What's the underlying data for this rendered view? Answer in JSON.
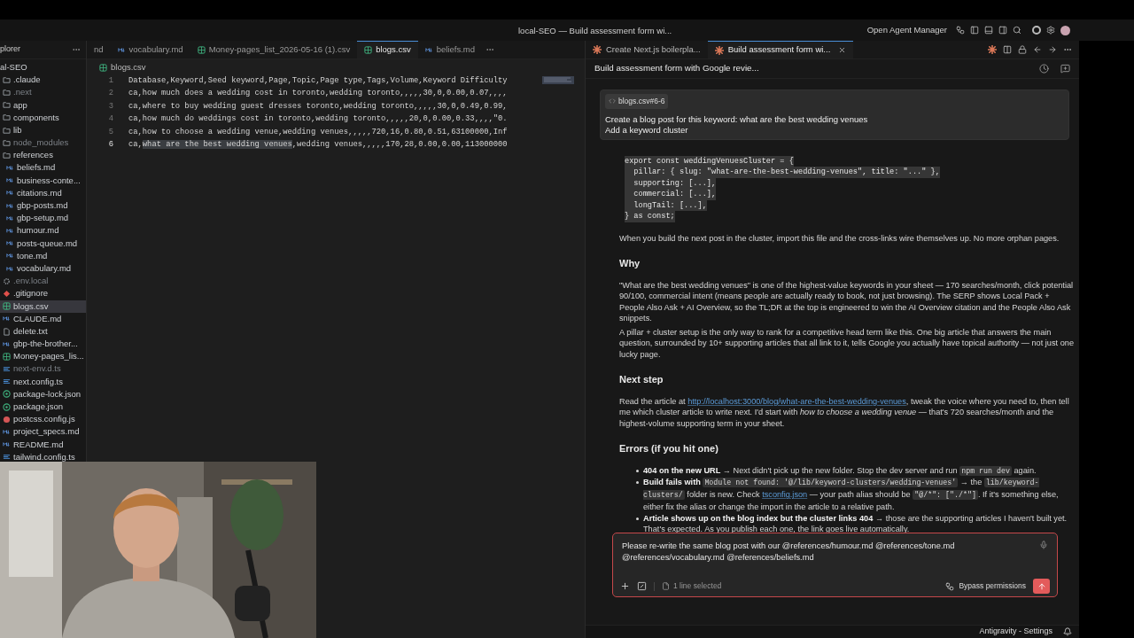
{
  "window": {
    "title": "local-SEO — Build assessment form wi..."
  },
  "title_bar": {
    "button": "Open Agent Manager"
  },
  "explorer": {
    "title": "plorer",
    "root": "al-SEO",
    "items": [
      {
        "label": ".claude",
        "kind": "folder",
        "dimmed": false,
        "selected": false
      },
      {
        "label": ".next",
        "kind": "folder",
        "dimmed": true,
        "selected": false
      },
      {
        "label": "app",
        "kind": "folder",
        "dimmed": false,
        "selected": false
      },
      {
        "label": "components",
        "kind": "folder",
        "dimmed": false,
        "selected": false
      },
      {
        "label": "lib",
        "kind": "folder",
        "dimmed": false,
        "selected": false
      },
      {
        "label": "node_modules",
        "kind": "folder",
        "dimmed": true,
        "selected": false
      },
      {
        "label": "references",
        "kind": "folder",
        "dimmed": false,
        "selected": false,
        "children": [
          {
            "label": "beliefs.md",
            "kind": "md",
            "dimmed": false,
            "selected": false
          },
          {
            "label": "business-conte...",
            "kind": "md",
            "dimmed": false,
            "selected": false
          },
          {
            "label": "citations.md",
            "kind": "md",
            "dimmed": false,
            "selected": false
          },
          {
            "label": "gbp-posts.md",
            "kind": "md",
            "dimmed": false,
            "selected": false
          },
          {
            "label": "gbp-setup.md",
            "kind": "md",
            "dimmed": false,
            "selected": false
          },
          {
            "label": "humour.md",
            "kind": "md",
            "dimmed": false,
            "selected": false
          },
          {
            "label": "posts-queue.md",
            "kind": "md",
            "dimmed": false,
            "selected": false
          },
          {
            "label": "tone.md",
            "kind": "md",
            "dimmed": false,
            "selected": false
          },
          {
            "label": "vocabulary.md",
            "kind": "md",
            "dimmed": false,
            "selected": false
          }
        ]
      },
      {
        "label": ".env.local",
        "kind": "env",
        "dimmed": true,
        "selected": false
      },
      {
        "label": ".gitignore",
        "kind": "git",
        "dimmed": false,
        "selected": false
      },
      {
        "label": "blogs.csv",
        "kind": "csv",
        "dimmed": false,
        "selected": true
      },
      {
        "label": "CLAUDE.md",
        "kind": "md",
        "dimmed": false,
        "selected": false
      },
      {
        "label": "delete.txt",
        "kind": "txt",
        "dimmed": false,
        "selected": false
      },
      {
        "label": "gbp-the-brother...",
        "kind": "md",
        "dimmed": false,
        "selected": false
      },
      {
        "label": "Money-pages_lis...",
        "kind": "csv",
        "dimmed": false,
        "selected": false
      },
      {
        "label": "next-env.d.ts",
        "kind": "ts",
        "dimmed": true,
        "selected": false
      },
      {
        "label": "next.config.ts",
        "kind": "ts",
        "dimmed": false,
        "selected": false
      },
      {
        "label": "package-lock.json",
        "kind": "json",
        "dimmed": false,
        "selected": false
      },
      {
        "label": "package.json",
        "kind": "json",
        "dimmed": false,
        "selected": false
      },
      {
        "label": "postcss.config.js",
        "kind": "js",
        "dimmed": false,
        "selected": false
      },
      {
        "label": "project_specs.md",
        "kind": "md",
        "dimmed": false,
        "selected": false
      },
      {
        "label": "README.md",
        "kind": "md",
        "dimmed": false,
        "selected": false
      },
      {
        "label": "tailwind.config.ts",
        "kind": "ts",
        "dimmed": false,
        "selected": false
      }
    ]
  },
  "editor_tabs": [
    {
      "label": "nd",
      "kind": "none",
      "selected": false
    },
    {
      "label": "vocabulary.md",
      "kind": "md",
      "selected": false
    },
    {
      "label": "Money-pages_list_2026-05-16 (1).csv",
      "kind": "csv",
      "selected": false
    },
    {
      "label": "blogs.csv",
      "kind": "csv",
      "selected": true
    },
    {
      "label": "beliefs.md",
      "kind": "md",
      "selected": false
    }
  ],
  "editor": {
    "file": "blogs.csv",
    "lines": [
      {
        "number": "1",
        "active": false,
        "parts": [
          {
            "text": "Database,Keyword,Seed keyword,Page,Topic,Page type,Tags,Volume,Keyword Difficulty",
            "selected": false
          }
        ]
      },
      {
        "number": "2",
        "active": false,
        "parts": [
          {
            "text": "ca,how much does a wedding cost in toronto,wedding toronto,,,,,30,0,0.00,0.07,,,,",
            "selected": false
          }
        ]
      },
      {
        "number": "3",
        "active": false,
        "parts": [
          {
            "text": "ca,where to buy wedding guest dresses toronto,wedding toronto,,,,,30,0,0.49,0.99,",
            "selected": false
          }
        ]
      },
      {
        "number": "4",
        "active": false,
        "parts": [
          {
            "text": "ca,how much do weddings cost in toronto,wedding toronto,,,,,20,0,0.00,0.33,,,,\"0.",
            "selected": false
          }
        ]
      },
      {
        "number": "5",
        "active": false,
        "parts": [
          {
            "text": "ca,how to choose a wedding venue,wedding venues,,,,,720,16,0.80,0.51,63100000,Inf",
            "selected": false
          }
        ]
      },
      {
        "number": "6",
        "active": true,
        "parts": [
          {
            "text": "ca,",
            "selected": false
          },
          {
            "text": "what are the best wedding venues",
            "selected": true
          },
          {
            "text": ",wedding venues,,,,,170,28,0.00,0.00,113000000",
            "selected": false
          }
        ]
      }
    ]
  },
  "chat_tabs": [
    {
      "label": "Create Next.js boilerpla...",
      "selected": false
    },
    {
      "label": "Build assessment form wi...",
      "selected": true
    }
  ],
  "chat": {
    "title": "Build assessment form with Google revie...",
    "prompt": {
      "chip": "blogs.csv#6-6",
      "lines": [
        "Create a blog post for this keyword: what are the best wedding venues",
        "Add a keyword cluster"
      ]
    },
    "blocks": [
      {
        "kind": "code",
        "lines": [
          "export const weddingVenuesCluster = {",
          "  pillar: { slug: \"what-are-the-best-wedding-venues\", title: \"...\" },",
          "  supporting: [...],",
          "  commercial: [...],",
          "  longTail: [...],",
          "} as const;"
        ]
      },
      {
        "kind": "paragraph",
        "segments": [
          {
            "kind": "text",
            "text": "When you build the next post in the cluster, import this file and the cross-links wire themselves up. No more orphan pages."
          }
        ]
      },
      {
        "kind": "heading",
        "text": "Why"
      },
      {
        "kind": "paragraph",
        "segments": [
          {
            "kind": "text",
            "text": "\"What are the best wedding venues\" is one of the highest-value keywords in your sheet — 170 searches/month, click potential 90/100, commercial intent (means people are actually ready to book, not just browsing). The SERP shows Local Pack + People Also Ask + AI Overview, so the TL;DR at the top is engineered to win the AI Overview citation and the People Also Ask snippets."
          }
        ]
      },
      {
        "kind": "paragraph",
        "segments": [
          {
            "kind": "text",
            "text": "A pillar + cluster setup is the only way to rank for a competitive head term like this. One big article that answers the main question, surrounded by 10+ supporting articles that all link to it, tells Google you actually have topical authority — not just one lucky page."
          }
        ]
      },
      {
        "kind": "heading",
        "text": "Next step"
      },
      {
        "kind": "paragraph",
        "segments": [
          {
            "kind": "text",
            "text": "Read the article at "
          },
          {
            "kind": "link",
            "text": "http://localhost:3000/blog/what-are-the-best-wedding-venues"
          },
          {
            "kind": "text",
            "text": ", tweak the voice where you need to, then tell me which cluster article to write next. I'd start with "
          },
          {
            "kind": "italic",
            "text": "how to choose a wedding venue"
          },
          {
            "kind": "text",
            "text": " — that's 720 searches/month and the highest-volume supporting term in your sheet."
          }
        ]
      },
      {
        "kind": "heading",
        "text": "Errors (if you hit one)"
      },
      {
        "kind": "list",
        "items": [
          [
            {
              "kind": "bold",
              "text": "404 on the new URL"
            },
            {
              "kind": "text",
              "text": " → Next didn't pick up the new folder. Stop the dev server and run "
            },
            {
              "kind": "code",
              "text": "npm run dev"
            },
            {
              "kind": "text",
              "text": " again."
            }
          ],
          [
            {
              "kind": "bold",
              "text": "Build fails with "
            },
            {
              "kind": "code",
              "text": "Module not found: '@/lib/keyword-clusters/wedding-venues'"
            },
            {
              "kind": "text",
              "text": " → the "
            },
            {
              "kind": "code",
              "text": "lib/keyword-clusters/"
            },
            {
              "kind": "text",
              "text": " folder is new. Check "
            },
            {
              "kind": "link",
              "text": "tsconfig.json"
            },
            {
              "kind": "text",
              "text": " — your path alias should be "
            },
            {
              "kind": "code",
              "text": "\"@/*\": [\"./*\"]"
            },
            {
              "kind": "text",
              "text": ". If it's something else, either fix the alias or change the import in the article to a relative path."
            }
          ],
          [
            {
              "kind": "bold",
              "text": "Article shows up on the blog index but the cluster links 404"
            },
            {
              "kind": "text",
              "text": " → those are the supporting articles I haven't built yet. That's expected. As you publish each one, the link goes live automatically."
            }
          ]
        ]
      }
    ]
  },
  "composer": {
    "value": "Please re-write the same blog post with our @references/humour.md @references/tone.md @references/vocabulary.md @references/beliefs.md",
    "context": "1 line selected",
    "mode": "Bypass permissions"
  },
  "status_bar": {
    "text": "Antigravity - Settings"
  }
}
